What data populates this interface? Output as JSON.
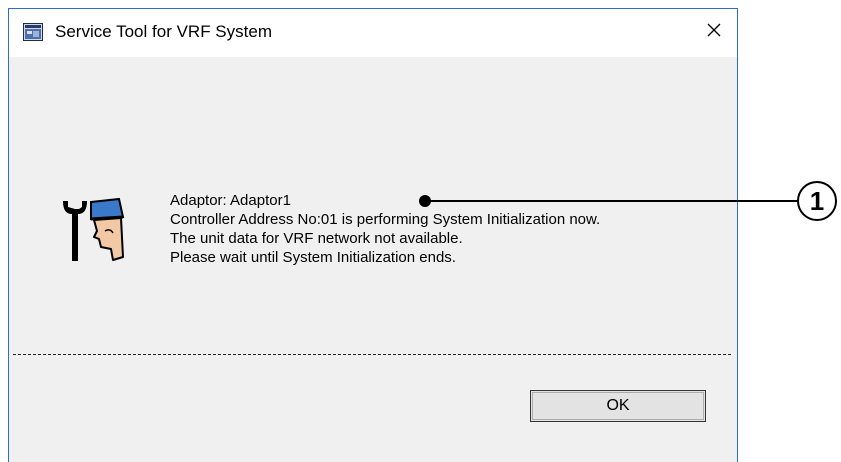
{
  "window": {
    "title": "Service Tool for VRF System",
    "close_glyph": "✕"
  },
  "message": {
    "lines": [
      "Adaptor:  Adaptor1",
      "Controller Address No:01 is performing System Initialization now.",
      "The unit data for VRF network not available.",
      "Please wait until System Initialization ends."
    ]
  },
  "buttons": {
    "ok_label": "OK"
  },
  "annotation": {
    "callout_label": "1"
  },
  "icons": {
    "app": "app-window-icon",
    "service": "service-wrench-person-icon",
    "close": "close-icon"
  },
  "colors": {
    "window_border": "#2d6bd6",
    "dialog_bg": "#f0f0f0",
    "titlebar_bg": "#ffffff",
    "cap_blue": "#3a78c9",
    "skin": "#f3c9a5"
  }
}
